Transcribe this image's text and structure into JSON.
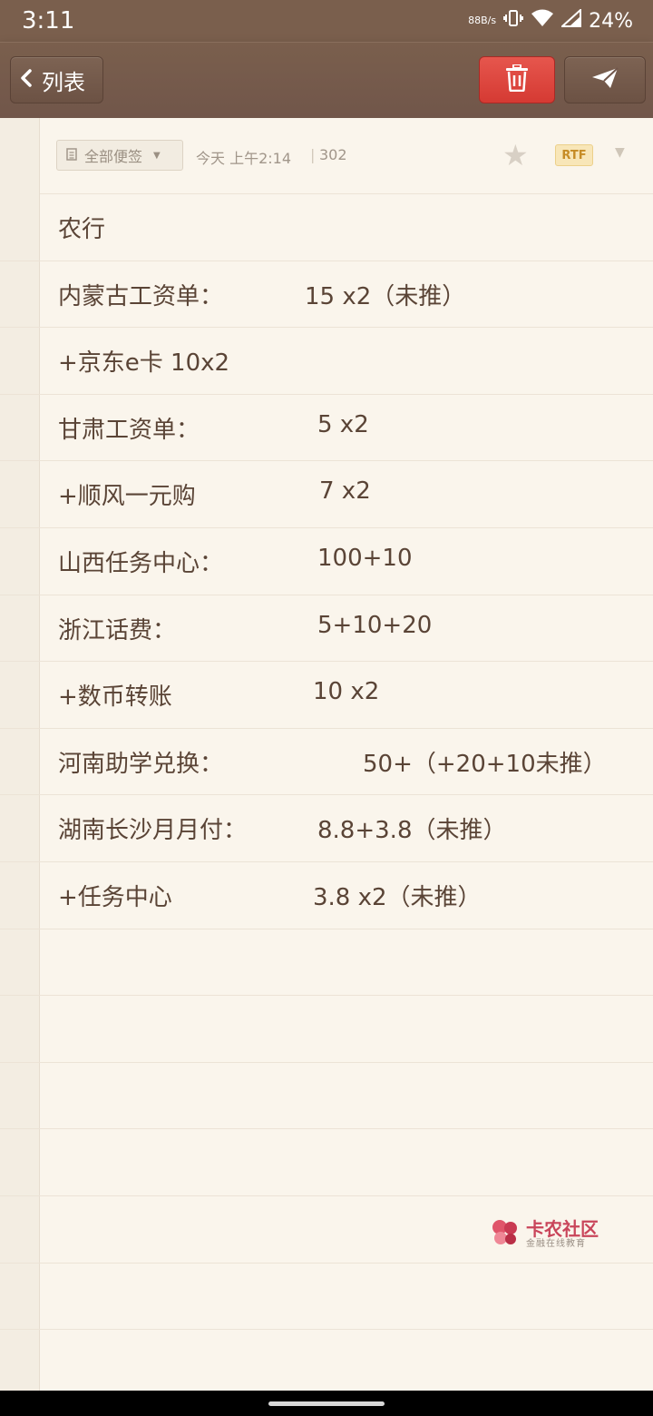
{
  "status_bar": {
    "time": "3:11",
    "net_speed": "88B/s",
    "battery": "24%"
  },
  "toolbar": {
    "back_label": "列表"
  },
  "meta": {
    "folder": "全部便签",
    "date": "今天 上午2:14",
    "count": "302",
    "format_badge": "RTF"
  },
  "note": {
    "lines": [
      {
        "label": "农行",
        "value": ""
      },
      {
        "label": "内蒙古工资单：",
        "value": "15   x2（未推）"
      },
      {
        "label": "+京东e卡   10x2",
        "value": ""
      },
      {
        "label": "甘肃工资单：",
        "value": "5   x2"
      },
      {
        "label": "+顺风一元购",
        "value": "7  x2"
      },
      {
        "label": "山西任务中心：",
        "value": "100+10"
      },
      {
        "label": "浙江话费：",
        "value": "5+10+20"
      },
      {
        "label": "+数币转账",
        "value": "10   x2"
      },
      {
        "label": "河南助学兑换：",
        "value": "50+（+20+10未推）"
      },
      {
        "label": "湖南长沙月月付：",
        "value": "8.8+3.8（未推）"
      },
      {
        "label": "+任务中心",
        "value": "3.8   x2（未推）"
      }
    ]
  },
  "watermark": {
    "title": "卡农社区",
    "subtitle": "金融在线教育"
  },
  "colors": {
    "toolbar_brown": "#7a5f4d",
    "delete_red": "#e04b43",
    "paper": "#faf5ec",
    "text": "#5a4436"
  },
  "icons": [
    "chevron-left-icon",
    "trash-icon",
    "send-icon",
    "note-icon",
    "star-icon",
    "caret-down-icon",
    "wifi-icon",
    "signal-icon",
    "vibrate-icon",
    "battery-icon"
  ]
}
